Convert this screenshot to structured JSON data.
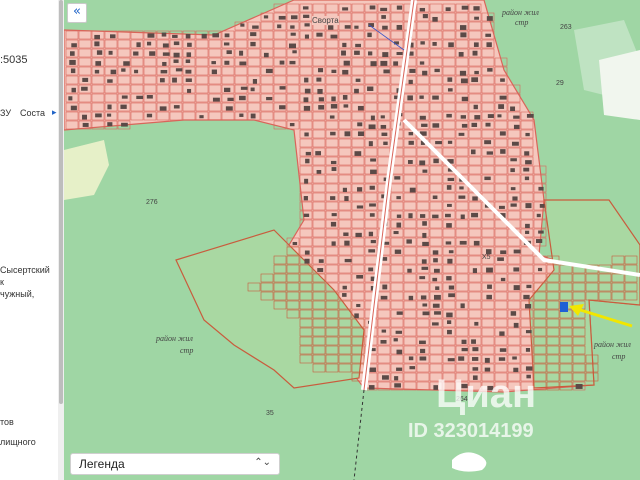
{
  "sidebar": {
    "fragments": [
      ":5035",
      "ЗУ",
      "Соста",
      "Сысертский",
      "к",
      "чужный,",
      "тов",
      "лищного"
    ],
    "tab_arrow": "▸"
  },
  "map": {
    "collapse_glyph": "«",
    "legend_label": "Легенда",
    "legend_chevron": "⌃⌄",
    "street_label": "Сворта",
    "district_labels": [
      "район жил",
      "стр",
      "район жил",
      "стр",
      "район жил",
      "стр"
    ],
    "parcel_numbers": [
      "263",
      "29",
      "276",
      "35",
      "264",
      "Х5"
    ],
    "watermark_brand": "Циан",
    "watermark_id": "ID 323014199",
    "colors": {
      "forest": "#9fd6a4",
      "urban_fill": "#f5c7bd",
      "urban_line": "#d9655a",
      "light_zone": "#d7ebc1",
      "grass_parcel_line": "#c95c3d",
      "building": "#5b4a47",
      "marker": "#1e5fd6",
      "arrow": "#f2e600"
    }
  }
}
